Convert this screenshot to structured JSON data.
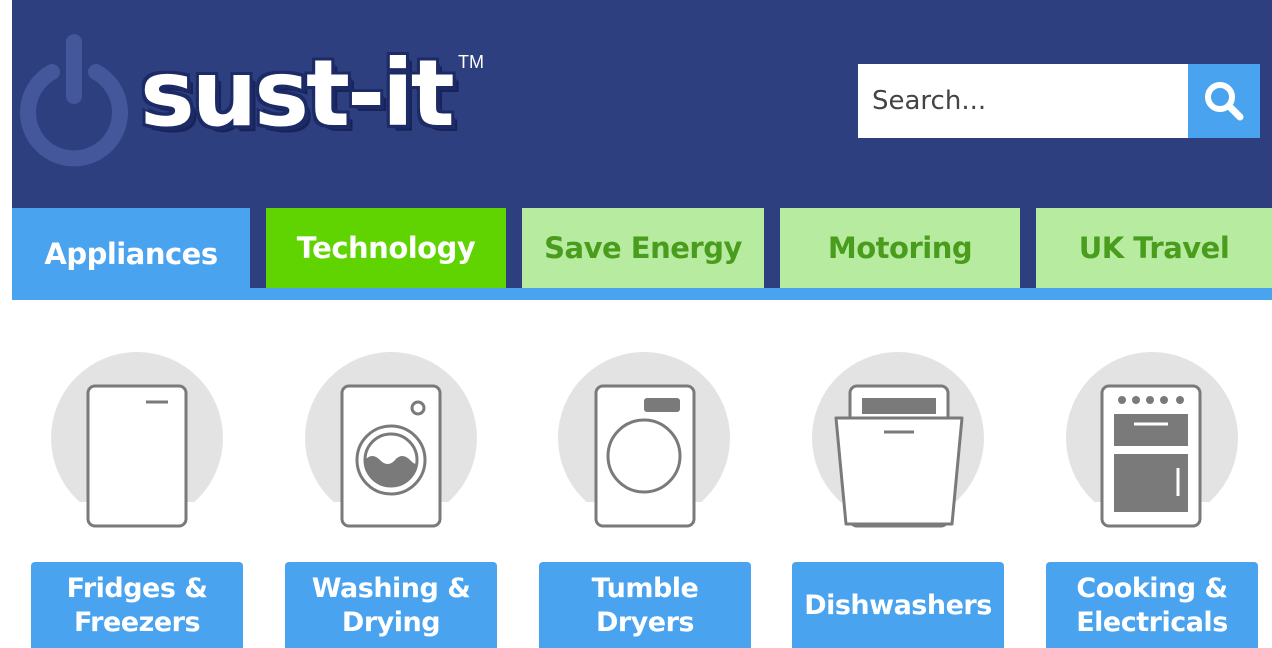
{
  "brand": {
    "name": "sust-it",
    "tm": "TM"
  },
  "search": {
    "placeholder": "Search...",
    "button_icon": "search-icon"
  },
  "colors": {
    "header_bg": "#2e3f80",
    "accent_blue": "#4aa3ef",
    "tech_green": "#5fd400",
    "light_green": "#b6eba0",
    "light_green_text": "#4a9c1c"
  },
  "nav": {
    "tabs": [
      {
        "label": "Appliances",
        "state": "active"
      },
      {
        "label": "Technology",
        "state": "highlight"
      },
      {
        "label": "Save Energy",
        "state": "normal"
      },
      {
        "label": "Motoring",
        "state": "normal"
      },
      {
        "label": "UK Travel",
        "state": "normal"
      }
    ]
  },
  "categories": [
    {
      "label": "Fridges &\nFreezers",
      "icon": "fridge-icon"
    },
    {
      "label": "Washing &\nDrying",
      "icon": "washing-machine-icon"
    },
    {
      "label": "Tumble\nDryers",
      "icon": "tumble-dryer-icon"
    },
    {
      "label": "Dishwashers",
      "icon": "dishwasher-icon"
    },
    {
      "label": "Cooking &\nElectricals",
      "icon": "cooker-icon"
    }
  ]
}
